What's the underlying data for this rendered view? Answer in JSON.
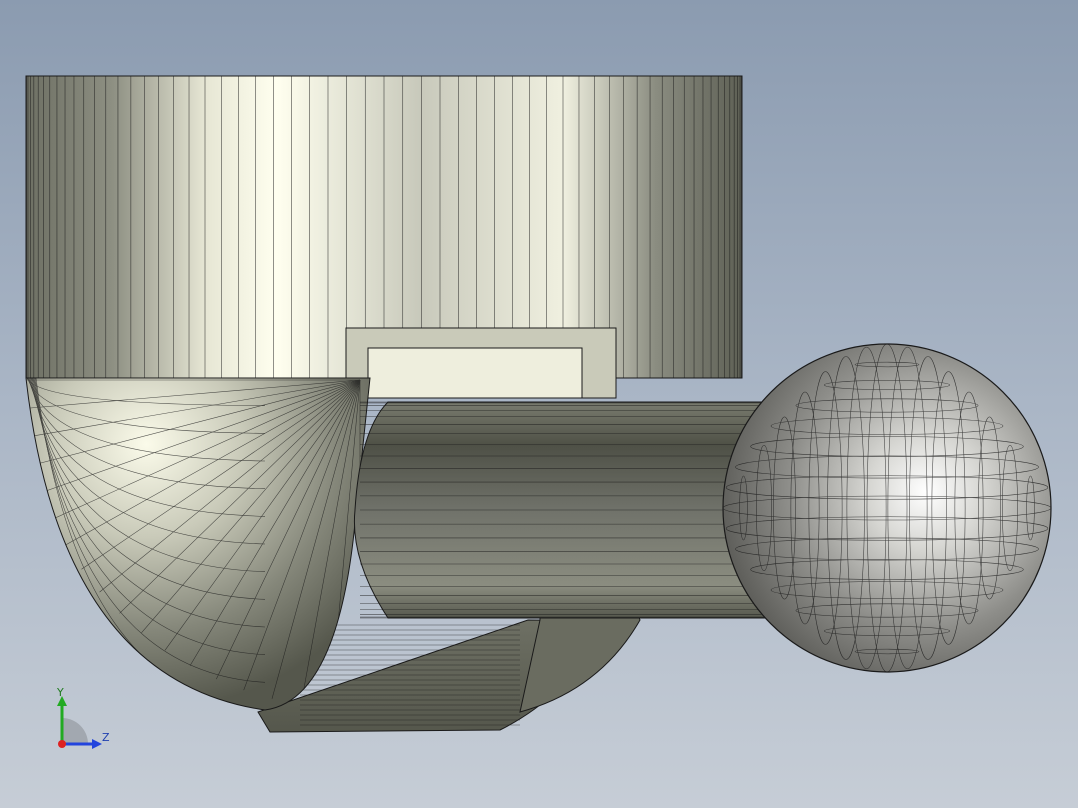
{
  "viewport": {
    "background_top": "#8b9bb0",
    "background_bottom": "#c6cdd6",
    "edge_color": "#1a1a1a",
    "face_color_light": "#f4f4e6",
    "face_color_dark": "#5c5e52"
  },
  "triad": {
    "y_label": "Y",
    "z_label": "Z",
    "y_color": "#22aa22",
    "z_color": "#2244dd",
    "x_color": "#dd2222"
  }
}
